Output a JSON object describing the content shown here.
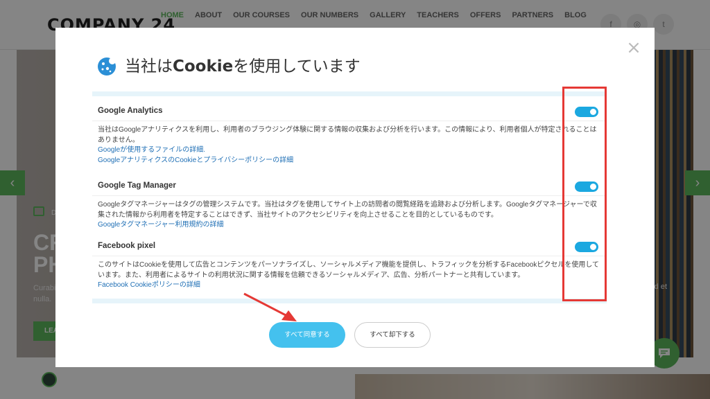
{
  "site": {
    "logo": "COMPANY 24",
    "nav": [
      "HOME",
      "ABOUT",
      "OUR COURSES",
      "OUR NUMBERS",
      "GALLERY",
      "TEACHERS",
      "OFFERS",
      "PARTNERS",
      "BLOG"
    ],
    "social": [
      "f",
      "◎",
      "t"
    ],
    "hero": {
      "date_prefix": "D",
      "title": "CR PH",
      "text_line1": "Curabi",
      "text_line2": "nulla.",
      "text_right": "ed et",
      "button": "LEA"
    },
    "accent_color": "#5cb85c"
  },
  "modal": {
    "title_prefix": "当社は",
    "title_bold": "Cookie",
    "title_suffix": "を使用しています",
    "close": "×",
    "sections": [
      {
        "name": "Google Analytics",
        "enabled": true,
        "description": "当社はGoogleアナリティクスを利用し、利用者のブラウジング体験に関する情報の収集および分析を行います。この情報により、利用者個人が特定されることはありません。",
        "links": [
          "Googleが使用するファイルの詳細.",
          "GoogleアナリティクスのCookieとプライバシーポリシーの詳細"
        ]
      },
      {
        "name": "Google Tag Manager",
        "enabled": true,
        "description": "Googleタグマネージャーはタグの管理システムです。当社はタグを使用してサイト上の訪問者の閲覧経路を追跡および分析します。Googleタグマネージャーで収集された情報から利用者を特定することはできず、当社サイトのアクセシビリティを向上させることを目的としているものです。",
        "links": [
          "Googleタグマネージャー利用規約の詳細"
        ]
      },
      {
        "name": "Facebook pixel",
        "enabled": true,
        "description": "このサイトはCookieを使用して広告とコンテンツをパーソナライズし、ソーシャルメディア機能を提供し、トラフィックを分析するFacebookピクセルを使用しています。また、利用者によるサイトの利用状況に関する情報を信頼できるソーシャルメディア、広告、分析パートナーと共有しています。",
        "links": [
          "Facebook Cookieポリシーの詳細"
        ]
      }
    ],
    "accept_label": "すべて同意する",
    "decline_label": "すべて却下する",
    "toggle_color": "#1ba8e0",
    "accept_color": "#44c1ee"
  },
  "annotation": {
    "box_color": "#e53935"
  }
}
